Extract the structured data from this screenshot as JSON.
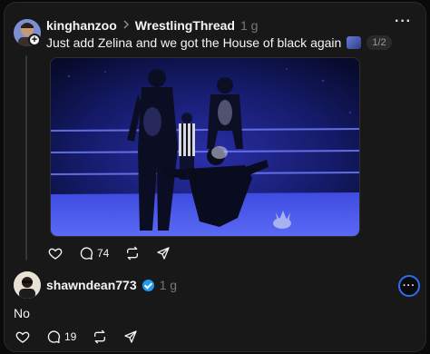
{
  "post1": {
    "username": "kinghanzoo",
    "community": "WrestlingThread",
    "time": "1 g",
    "text": "Just add Zelina and we got the House of black again",
    "page_indicator": "1/2",
    "actions": {
      "reply_count": "74"
    }
  },
  "post2": {
    "username": "shawndean773",
    "time": "1 g",
    "text": "No",
    "actions": {
      "reply_count": "19"
    }
  },
  "colors": {
    "background": "#0a0a0a",
    "panel": "#181818",
    "verified_blue": "#1d9bf0",
    "ring_blue": "#2f6ef0"
  },
  "icons": [
    "plus-icon",
    "chevron-right-icon",
    "more-icon",
    "heart-icon",
    "comment-icon",
    "repost-icon",
    "share-icon",
    "verified-icon",
    "ai-ring-icon"
  ]
}
